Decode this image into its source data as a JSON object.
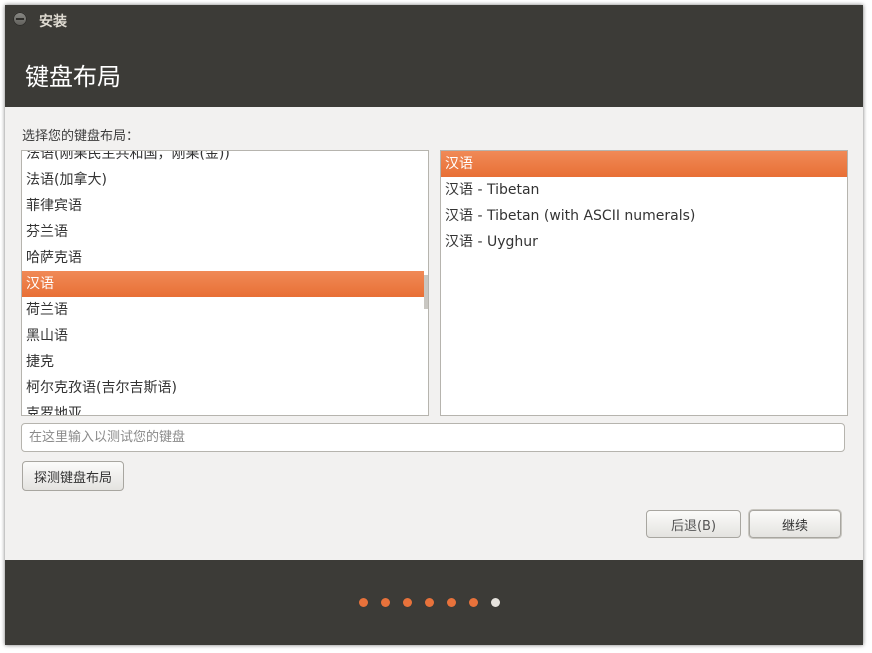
{
  "window": {
    "title": "安装"
  },
  "header": {
    "title": "键盘布局"
  },
  "instruction": "选择您的键盘布局：",
  "layouts": [
    "法语(刚果民主共和国，刚果(金))",
    "法语(加拿大)",
    "菲律宾语",
    "芬兰语",
    "哈萨克语",
    "汉语",
    "荷兰语",
    "黑山语",
    "捷克",
    "柯尔克孜语(吉尔吉斯语)",
    "克罗地亚"
  ],
  "variants": [
    "汉语",
    "汉语 - Tibetan",
    "汉语 - Tibetan (with ASCII numerals)",
    "汉语 - Uyghur"
  ],
  "test_input": {
    "value": "",
    "placeholder": "在这里输入以测试您的键盘"
  },
  "buttons": {
    "detect": "探测键盘布局",
    "back": "后退(B)",
    "continue": "继续"
  },
  "progress": {
    "total_steps": 7,
    "current_step": 7
  },
  "colors": {
    "accent": "#e86f35",
    "dark": "#3c3b37"
  }
}
